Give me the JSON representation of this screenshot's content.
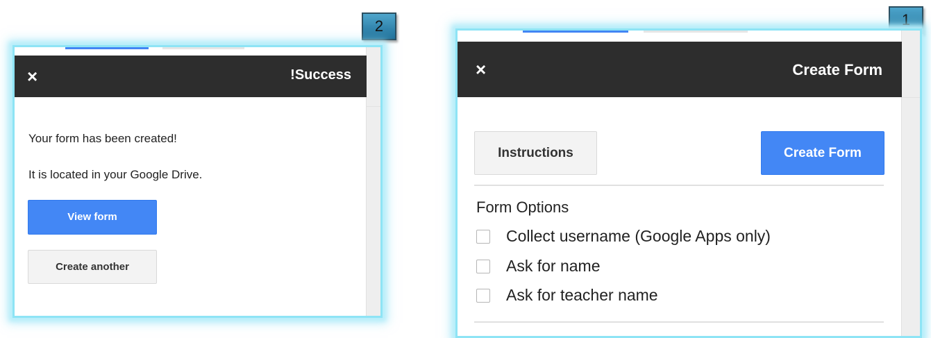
{
  "success_panel": {
    "step_number": "2",
    "title": "!Success",
    "close_icon": "×",
    "message_created": "Your form has been created!",
    "message_location": "It is located in your Google Drive.",
    "view_form_label": "View form",
    "create_another_label": "Create another"
  },
  "create_panel": {
    "step_number": "1",
    "title": "Create Form",
    "close_icon": "×",
    "instructions_label": "Instructions",
    "create_form_label": "Create Form",
    "form_options_title": "Form Options",
    "options": [
      {
        "label": "Collect username (Google Apps only)",
        "checked": false
      },
      {
        "label": "Ask for name",
        "checked": false
      },
      {
        "label": "Ask for teacher name",
        "checked": false
      }
    ]
  },
  "colors": {
    "header_bg": "#2d2d2d",
    "primary_button": "#4387f5",
    "frame_glow": "#8ee4f5",
    "badge": "#2f86b2"
  }
}
